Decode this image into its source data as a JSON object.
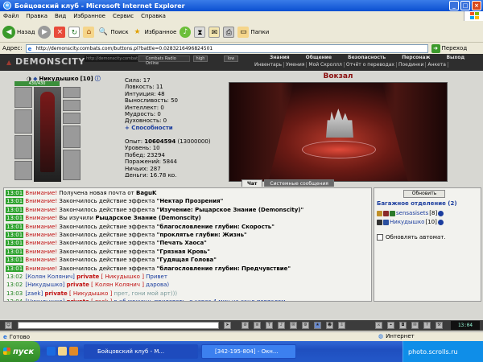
{
  "window": {
    "title": "Бойцовский клуб - Microsoft Internet Explorer",
    "menu": [
      "Файл",
      "Правка",
      "Вид",
      "Избранное",
      "Сервис",
      "Справка"
    ]
  },
  "toolbar": {
    "back": "Назад",
    "search": "Поиск",
    "favorites": "Избранное",
    "folders": "Папки"
  },
  "address": {
    "label": "Адрес:",
    "url": "http://demonscity.combats.com/buttons.pl?battle=0.0283216496824501",
    "go": "Переход"
  },
  "game": {
    "logo": "DEMONSCITY",
    "url_short": "http://demonscity.combats.com/buttons.pl",
    "radio": "Combats Radio Online",
    "quality": [
      "high",
      "low"
    ],
    "nav_top": [
      "Знания",
      "Общение",
      "Безопасность",
      "Персонаж",
      "Выход"
    ],
    "nav_bottom": [
      "Инвентарь",
      "Умения",
      "Мой Скроллл",
      "Отчёт о переводах",
      "Поединки",
      "Анкета"
    ],
    "character": {
      "name": "Никудышко",
      "level": "[10]",
      "hp": "430/430",
      "stats": [
        "Сила: 17",
        "Ловкость: 11",
        "Интуиция: 48",
        "Выносливость: 50",
        "Интеллект: 0",
        "Мудрость: 0",
        "Духовность: 0"
      ],
      "abilities_link": "+ Способности",
      "exp_label": "Опыт: ",
      "exp_value": "10604594",
      "exp_next": " (13000000)",
      "stats2": [
        "Уровень: 10",
        "Побед: 23294",
        "Поражений: 5844",
        "Ничьих: 287",
        "Деньги: 16.78 кр."
      ]
    },
    "location": "Вокзал",
    "tabs": [
      "Чат",
      "Системные сообщения"
    ]
  },
  "chat": {
    "lines": [
      {
        "time": "13:01",
        "kind": "warn",
        "label": "Внимание!",
        "text": " Получена новая почта от ",
        "bold": "BaguK",
        "tail": ""
      },
      {
        "time": "13:01",
        "kind": "warn",
        "label": "Внимание!",
        "text": " Закончилось действие эффекта ",
        "bold": "\"Нектар Прозрения\"",
        "tail": ""
      },
      {
        "time": "13:01",
        "kind": "warn",
        "label": "Внимание!",
        "text": " Закончилось действие эффекта ",
        "bold": "\"Изучение: Рыцарское Знание (Demonscity)\"",
        "tail": ""
      },
      {
        "time": "13:01",
        "kind": "warn",
        "label": "Внимание!",
        "text": " Вы изучили ",
        "bold": "Рыцарское Знание (Demonscity)",
        "tail": ""
      },
      {
        "time": "13:01",
        "kind": "warn",
        "label": "Внимание!",
        "text": " Закончилось действие эффекта ",
        "bold": "\"благословление глубин: Скорость\"",
        "tail": ""
      },
      {
        "time": "13:01",
        "kind": "warn",
        "label": "Внимание!",
        "text": " Закончилось действие эффекта ",
        "bold": "\"проклятье глубин: Жизнь\"",
        "tail": ""
      },
      {
        "time": "13:01",
        "kind": "warn",
        "label": "Внимание!",
        "text": " Закончилось действие эффекта ",
        "bold": "\"Печать Хаоса\"",
        "tail": ""
      },
      {
        "time": "13:01",
        "kind": "warn",
        "label": "Внимание!",
        "text": " Закончилось действие эффекта ",
        "bold": "\"Грязная Кровь\"",
        "tail": ""
      },
      {
        "time": "13:01",
        "kind": "warn",
        "label": "Внимание!",
        "text": " Закончилось действие эффекта ",
        "bold": "\"Гудящая Голова\"",
        "tail": ""
      },
      {
        "time": "13:01",
        "kind": "warn",
        "label": "Внимание!",
        "text": " Закончилось действие эффекта ",
        "bold": "\"благословление глубин: Предчувствие\"",
        "tail": ""
      },
      {
        "time": "13:02",
        "kind": "priv",
        "from": "[Колян Колянич]",
        "to": "[ Никудышко ]",
        "msg": " Привет",
        "msgstyle": "blue"
      },
      {
        "time": "13:02",
        "kind": "priv",
        "from": "[Никудышко]",
        "to": "[ Колян Колянич ]",
        "msg": " дарова)",
        "msgstyle": "blue"
      },
      {
        "time": "13:03",
        "kind": "priv",
        "from": "[zaek]",
        "to": "[ Никудышко ]",
        "msg": " прет, гони мой арт)))",
        "msgstyle": "gray"
      },
      {
        "time": "13:04",
        "kind": "priv",
        "from": "[Никудышко]",
        "to": "[ zaek ]",
        "msg": " в аб можешь прилететь, я через 4 мин на санд порталом",
        "msgstyle": "blue"
      },
      {
        "time": "13:04",
        "kind": "priv",
        "from": "[Никудышко]",
        "to": "[ klan ]",
        "msg": " привет)",
        "msgstyle": "blue"
      }
    ],
    "private_word": "private"
  },
  "bag": {
    "refresh": "Обновить",
    "title": "Багажное отделение (2)",
    "users": [
      {
        "name": "sensasisets",
        "level": "[8]"
      },
      {
        "name": "Никудышко",
        "level": "[10]"
      }
    ],
    "auto_refresh": "Обновлять автомат."
  },
  "gamebar": {
    "clock": "13:04"
  },
  "status": {
    "left": "Готово",
    "zone": "Интернет"
  },
  "taskbar": {
    "start": "пуск",
    "tasks": [
      "Бойцовский клуб - M...",
      "[342-195-804] - Окн..."
    ],
    "tray": "photo.scrolls.ru"
  },
  "colors": {
    "warn": "#c01010",
    "nick": "#1b3d9e",
    "timestamp": "#2fa32f"
  }
}
